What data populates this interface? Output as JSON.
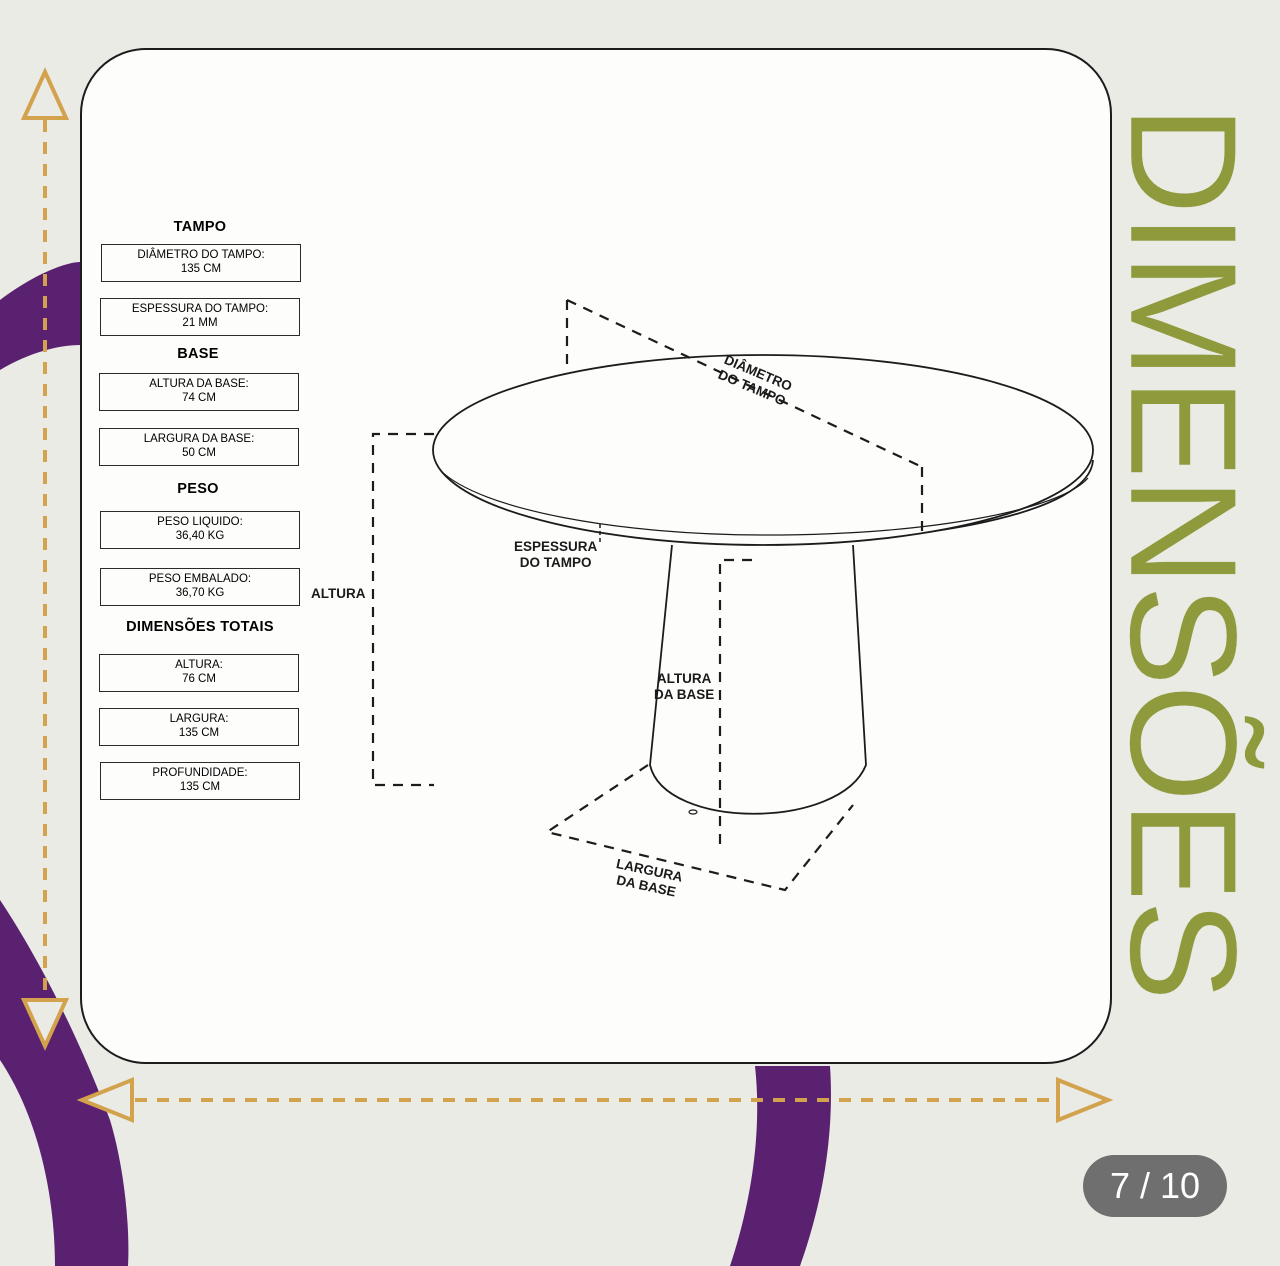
{
  "heading": "DIMENSÕES",
  "pager": {
    "current": "7",
    "total": "10",
    "separator": " / "
  },
  "colors": {
    "accent_purple": "#5a2170",
    "heading_olive": "#8e9a3c",
    "arrow_gold": "#d2a24c",
    "pager_bg": "#6f6f6f"
  },
  "specs": {
    "tampo": {
      "title": "TAMPO",
      "diametro": {
        "label": "DIÂMETRO DO TAMPO:",
        "value": "135 CM"
      },
      "espessura": {
        "label": "ESPESSURA DO TAMPO:",
        "value": "21 MM"
      }
    },
    "base": {
      "title": "BASE",
      "altura": {
        "label": "ALTURA DA BASE:",
        "value": "74 CM"
      },
      "largura": {
        "label": "LARGURA DA BASE:",
        "value": "50 CM"
      }
    },
    "peso": {
      "title": "PESO",
      "liquido": {
        "label": "PESO LIQUIDO:",
        "value": "36,40 KG"
      },
      "embalado": {
        "label": "PESO EMBALADO:",
        "value": "36,70 KG"
      }
    },
    "totais": {
      "title": "DIMENSÕES TOTAIS",
      "altura": {
        "label": "ALTURA:",
        "value": "76 CM"
      },
      "largura": {
        "label": "LARGURA:",
        "value": "135 CM"
      },
      "profundidade": {
        "label": "PROFUNDIDADE:",
        "value": "135 CM"
      }
    }
  },
  "labels": {
    "diametro_tampo": [
      "DIÂMETRO",
      "DO TAMPO"
    ],
    "espessura_tampo": [
      "ESPESSURA",
      "DO TAMPO"
    ],
    "altura": "ALTURA",
    "altura_base": [
      "ALTURA",
      "DA BASE"
    ],
    "largura_base": [
      "LARGURA",
      "DA BASE"
    ]
  }
}
